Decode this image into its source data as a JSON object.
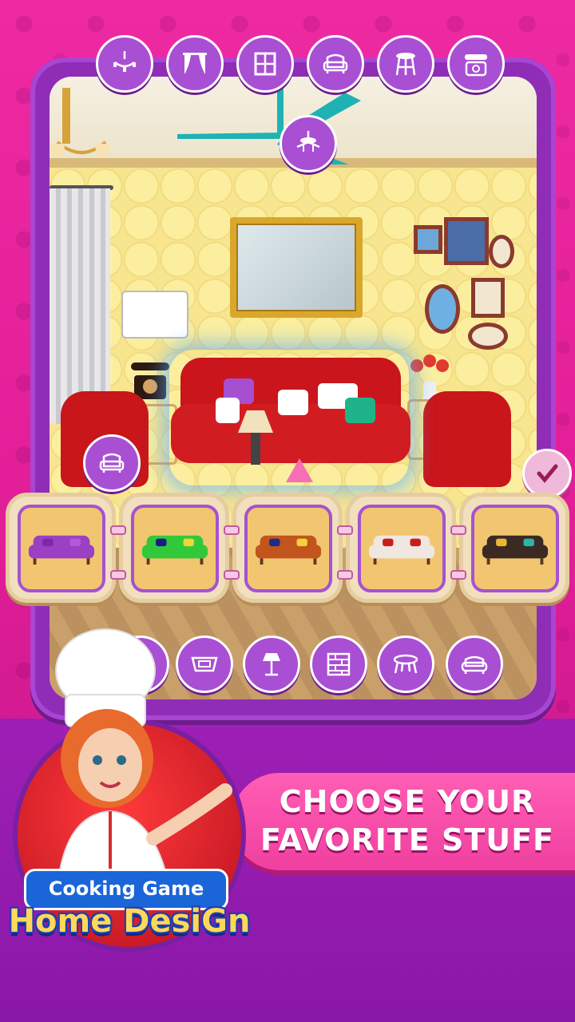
{
  "top_categories": [
    {
      "name": "chandelier-icon"
    },
    {
      "name": "curtain-icon"
    },
    {
      "name": "window-icon"
    },
    {
      "name": "armchair-icon"
    },
    {
      "name": "stool-icon"
    },
    {
      "name": "telephone-icon"
    }
  ],
  "bottom_categories": [
    {
      "name": "fireplace-icon"
    },
    {
      "name": "rug-icon"
    },
    {
      "name": "floor-lamp-icon"
    },
    {
      "name": "wallpaper-icon"
    },
    {
      "name": "coffee-table-icon"
    },
    {
      "name": "sofa-icon"
    }
  ],
  "sofa_options": [
    {
      "color": "#9b3fc4",
      "pillows": [
        "#7a2aa8",
        "#b45ad8"
      ]
    },
    {
      "color": "#31c93a",
      "pillows": [
        "#1a1a8a",
        "#f2d33a"
      ]
    },
    {
      "color": "#c2541d",
      "pillows": [
        "#1e2a8c",
        "#f2d33a"
      ]
    },
    {
      "color": "#efe7e0",
      "pillows": [
        "#c81d1d",
        "#c81d1d"
      ]
    },
    {
      "color": "#3b2a24",
      "pillows": [
        "#e8b932",
        "#2bb4a8"
      ]
    }
  ],
  "promo": {
    "line1": "CHOOSE YOUR",
    "line2": "FAVORITE STUFF"
  },
  "logo": {
    "top": "Cooking Game",
    "main": "Home DesiGn"
  },
  "colors": {
    "accent_purple": "#a94fd4",
    "background_pink": "#e81f9b",
    "promo_pink": "#ff5eb4"
  }
}
